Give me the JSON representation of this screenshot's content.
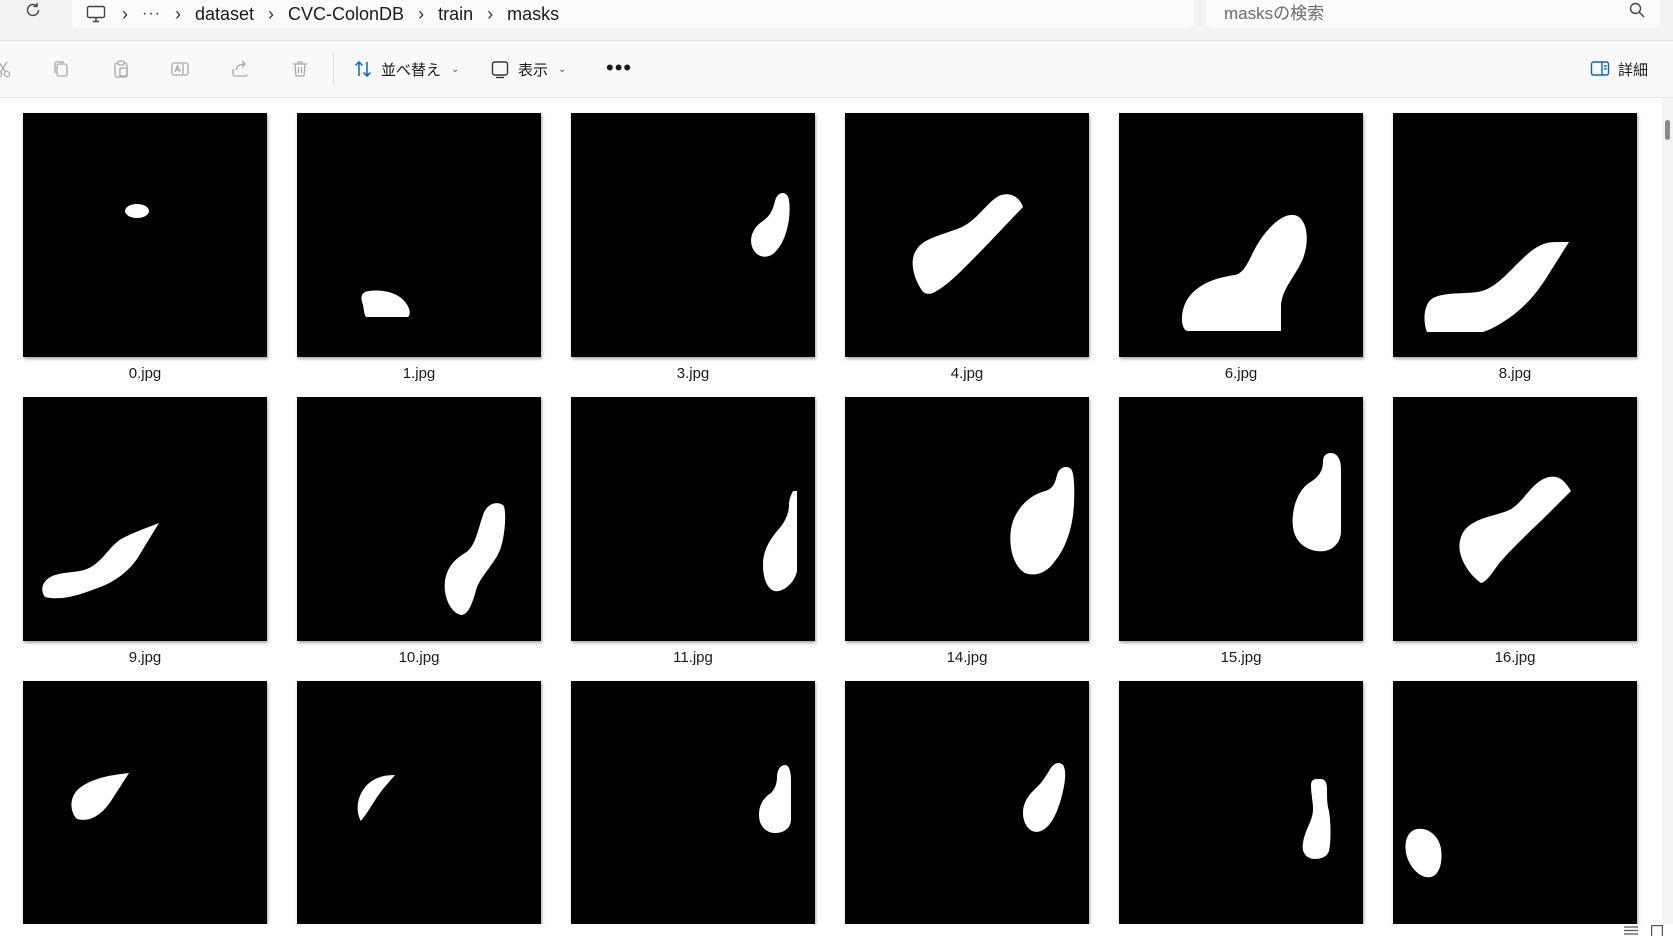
{
  "address": {
    "crumbs": [
      "dataset",
      "CVC-ColonDB",
      "train",
      "masks"
    ],
    "overflow_label": "···"
  },
  "search": {
    "placeholder": "masksの検索"
  },
  "toolbar": {
    "sort_label": "並べ替え",
    "view_label": "表示",
    "more_label": "•••",
    "details_label": "詳細",
    "icons": [
      "cut-icon",
      "copy-icon",
      "paste-icon",
      "rename-icon",
      "share-icon",
      "delete-icon"
    ]
  },
  "files": [
    {
      "name": "0.jpg"
    },
    {
      "name": "1.jpg"
    },
    {
      "name": "3.jpg"
    },
    {
      "name": "4.jpg"
    },
    {
      "name": "6.jpg"
    },
    {
      "name": "8.jpg"
    },
    {
      "name": "9.jpg"
    },
    {
      "name": "10.jpg"
    },
    {
      "name": "11.jpg"
    },
    {
      "name": "14.jpg"
    },
    {
      "name": "15.jpg"
    },
    {
      "name": "16.jpg"
    },
    {
      "name": ""
    },
    {
      "name": ""
    },
    {
      "name": ""
    },
    {
      "name": ""
    },
    {
      "name": ""
    },
    {
      "name": ""
    }
  ],
  "colors": {
    "mask_background": "#000000",
    "mask_foreground": "#ffffff",
    "accent": "#0067c0"
  }
}
